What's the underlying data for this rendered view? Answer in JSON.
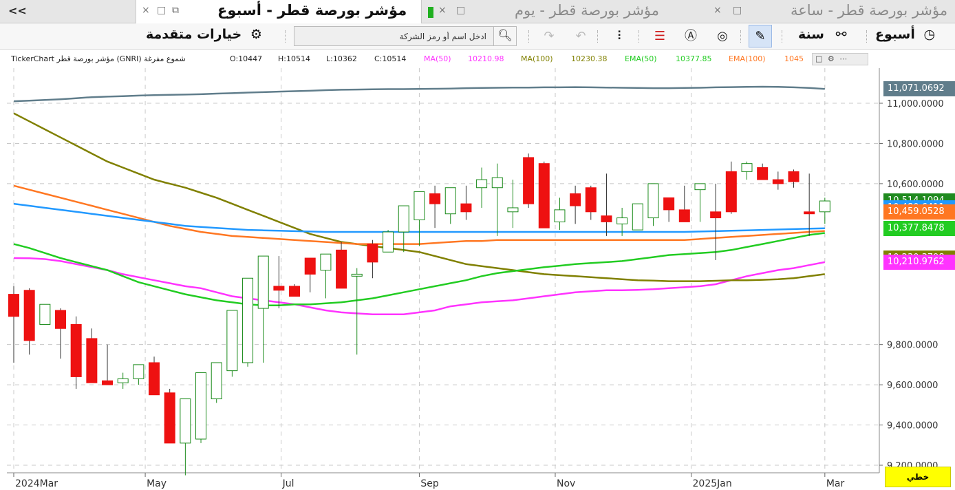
{
  "tabs": {
    "scroll_label": "<<",
    "items": [
      {
        "title": "مؤشر بورصة قطر - أسبوع",
        "active": true,
        "flag_color": ""
      },
      {
        "title": "مؤشر بورصة قطر - يوم",
        "active": false,
        "flag_color": "#20b020"
      },
      {
        "title": "مؤشر بورصة قطر - ساعة",
        "active": false,
        "flag_color": "#ffffff"
      }
    ],
    "close_glyph": "×",
    "restore_glyph": "□"
  },
  "toolbar": {
    "period_week": "أسبوع",
    "period_year": "سنة",
    "advanced_options": "خيارات متقدمة",
    "search_placeholder": "ادخل اسم أو رمز الشركة",
    "icons": [
      "clock-icon",
      "link-icon",
      "draw-tool-icon",
      "indicator-icon",
      "auto-icon",
      "horizontal-lines-icon",
      "candle-type-icon",
      "redo-icon",
      "undo-icon",
      "search-icon",
      "gear-icon"
    ]
  },
  "info_line": {
    "source": "TickerChart مؤشر بورصة قطر (GNRI) شموع مفرغة",
    "open": "O:10447",
    "high": "H:10514",
    "low": "L:10362",
    "close": "C:10514",
    "ma50_label": "MA(50)",
    "ma50_value": "10210.98",
    "ma100_label": "MA(100)",
    "ma100_value": "10230.38",
    "ema50_label": "EMA(50)",
    "ema50_value": "10377.85",
    "ema100_label": "EMA(100)",
    "ema100_value": "1045",
    "colors": {
      "ma50": "#ff33ff",
      "ma100": "#808000",
      "ema50": "#22cc22",
      "ema100": "#ff7722"
    }
  },
  "chart_data": {
    "type": "candlestick",
    "symbol": "GNRI",
    "x": [
      "2024-03-03",
      "2024-03-10",
      "2024-03-17",
      "2024-03-24",
      "2024-03-31",
      "2024-04-07",
      "2024-04-14",
      "2024-04-21",
      "2024-04-28",
      "2024-05-05",
      "2024-05-12",
      "2024-05-19",
      "2024-05-26",
      "2024-06-02",
      "2024-06-09",
      "2024-06-16",
      "2024-06-23",
      "2024-06-30",
      "2024-07-07",
      "2024-07-14",
      "2024-07-21",
      "2024-07-28",
      "2024-08-04",
      "2024-08-11",
      "2024-08-18",
      "2024-08-25",
      "2024-09-01",
      "2024-09-08",
      "2024-09-15",
      "2024-09-22",
      "2024-09-29",
      "2024-10-06",
      "2024-10-13",
      "2024-10-20",
      "2024-10-27",
      "2024-11-03",
      "2024-11-10",
      "2024-11-17",
      "2024-11-24",
      "2024-12-01",
      "2024-12-08",
      "2024-12-15",
      "2024-12-22",
      "2024-12-29",
      "2025-01-05",
      "2025-01-12",
      "2025-01-19",
      "2025-01-26",
      "2025-02-02",
      "2025-02-09",
      "2025-02-16",
      "2025-02-23",
      "2025-03-02"
    ],
    "open": [
      10050,
      10070,
      9900,
      9970,
      9900,
      9830,
      9620,
      9610,
      9630,
      9710,
      9560,
      9310,
      9330,
      9530,
      9670,
      9710,
      9980,
      10090,
      10090,
      10230,
      10170,
      10270,
      10140,
      10300,
      10260,
      10360,
      10420,
      10550,
      10450,
      10500,
      10580,
      10580,
      10460,
      10730,
      10700,
      10410,
      10550,
      10580,
      10440,
      10400,
      10370,
      10430,
      10530,
      10470,
      10570,
      10460,
      10660,
      10660,
      10680,
      10620,
      10660,
      10460,
      10460
    ],
    "high": [
      10090,
      10080,
      9950,
      9980,
      9940,
      9880,
      9800,
      9660,
      9690,
      9740,
      9580,
      9340,
      9530,
      9660,
      9720,
      9980,
      10100,
      10240,
      10100,
      10220,
      10250,
      10310,
      10180,
      10320,
      10370,
      10490,
      10560,
      10590,
      10580,
      10590,
      10680,
      10700,
      10620,
      10750,
      10710,
      10530,
      10590,
      10590,
      10650,
      10480,
      10490,
      10600,
      10520,
      10590,
      10580,
      10600,
      10710,
      10710,
      10700,
      10660,
      10670,
      10650,
      10530
    ],
    "low": [
      9710,
      9750,
      9900,
      9730,
      9580,
      9620,
      9600,
      9580,
      9600,
      9580,
      9340,
      9150,
      9310,
      9510,
      9640,
      9690,
      9710,
      9980,
      10080,
      10060,
      10030,
      10200,
      9750,
      10130,
      10260,
      10260,
      10290,
      10380,
      10400,
      10420,
      10480,
      10340,
      10380,
      10480,
      10380,
      10370,
      10400,
      10420,
      10340,
      10340,
      10370,
      10390,
      10410,
      10410,
      10410,
      10220,
      10450,
      10620,
      10650,
      10570,
      10580,
      10340,
      10400
    ],
    "close": [
      9940,
      9820,
      10000,
      9880,
      9640,
      9610,
      9600,
      9630,
      9700,
      9550,
      9310,
      9530,
      9660,
      9710,
      9970,
      10130,
      10240,
      10070,
      10040,
      10150,
      10250,
      10080,
      10150,
      10210,
      10360,
      10490,
      10560,
      10500,
      10580,
      10460,
      10620,
      10630,
      10480,
      10500,
      10380,
      10470,
      10490,
      10460,
      10410,
      10430,
      10500,
      10600,
      10470,
      10410,
      10600,
      10430,
      10460,
      10700,
      10620,
      10600,
      10610,
      10450,
      10514
    ],
    "series": [
      {
        "name": "MA(50)",
        "color": "#ff33ff",
        "values": [
          10230,
          10229,
          10225,
          10215,
          10200,
          10185,
          10170,
          10150,
          10135,
          10120,
          10105,
          10090,
          10080,
          10060,
          10040,
          10030,
          10020,
          10010,
          10000,
          9985,
          9970,
          9960,
          9955,
          9950,
          9950,
          9950,
          9960,
          9970,
          9990,
          10000,
          10010,
          10015,
          10020,
          10030,
          10040,
          10050,
          10060,
          10065,
          10070,
          10070,
          10072,
          10075,
          10080,
          10085,
          10090,
          10100,
          10120,
          10140,
          10155,
          10170,
          10180,
          10195,
          10210
        ]
      },
      {
        "name": "MA(100)",
        "color": "#808000",
        "values": [
          10950,
          10910,
          10870,
          10830,
          10790,
          10750,
          10710,
          10680,
          10650,
          10620,
          10600,
          10580,
          10555,
          10530,
          10500,
          10470,
          10440,
          10410,
          10380,
          10350,
          10330,
          10310,
          10300,
          10290,
          10280,
          10270,
          10260,
          10240,
          10220,
          10200,
          10190,
          10180,
          10170,
          10160,
          10150,
          10145,
          10140,
          10135,
          10130,
          10125,
          10120,
          10118,
          10115,
          10115,
          10115,
          10117,
          10120,
          10120,
          10122,
          10125,
          10130,
          10140,
          10150
        ]
      },
      {
        "name": "EMA(50)",
        "color": "#22cc22",
        "values": [
          10300,
          10280,
          10255,
          10230,
          10210,
          10190,
          10170,
          10140,
          10110,
          10090,
          10070,
          10050,
          10035,
          10020,
          10010,
          10000,
          9995,
          9995,
          10000,
          10000,
          10005,
          10010,
          10020,
          10030,
          10045,
          10060,
          10075,
          10090,
          10105,
          10120,
          10140,
          10155,
          10165,
          10175,
          10185,
          10192,
          10200,
          10205,
          10210,
          10215,
          10225,
          10235,
          10245,
          10250,
          10255,
          10260,
          10270,
          10285,
          10300,
          10315,
          10330,
          10345,
          10355
        ]
      },
      {
        "name": "EMA(100)",
        "color": "#ff7722",
        "values": [
          10590,
          10570,
          10550,
          10530,
          10510,
          10490,
          10470,
          10450,
          10430,
          10410,
          10390,
          10375,
          10360,
          10350,
          10340,
          10335,
          10330,
          10325,
          10320,
          10315,
          10310,
          10305,
          10300,
          10300,
          10300,
          10300,
          10300,
          10305,
          10310,
          10315,
          10315,
          10320,
          10320,
          10320,
          10320,
          10320,
          10320,
          10320,
          10320,
          10320,
          10320,
          10320,
          10320,
          10320,
          10325,
          10330,
          10335,
          10340,
          10345,
          10350,
          10355,
          10360,
          10365
        ]
      },
      {
        "name": "",
        "color": "#2299ff",
        "values": [
          10500,
          10490,
          10480,
          10470,
          10460,
          10450,
          10440,
          10430,
          10420,
          10410,
          10400,
          10390,
          10385,
          10380,
          10375,
          10370,
          10368,
          10366,
          10364,
          10362,
          10360,
          10360,
          10360,
          10360,
          10360,
          10360,
          10360,
          10360,
          10360,
          10360,
          10360,
          10360,
          10360,
          10360,
          10360,
          10360,
          10360,
          10360,
          10360,
          10360,
          10360,
          10360,
          10360,
          10360,
          10362,
          10364,
          10366,
          10368,
          10370,
          10372,
          10374,
          10376,
          10378
        ]
      },
      {
        "name": "",
        "color": "#607d8b",
        "values": [
          11010,
          11013,
          11016,
          11020,
          11025,
          11030,
          11033,
          11035,
          11038,
          11040,
          11042,
          11043,
          11045,
          11048,
          11050,
          11053,
          11055,
          11058,
          11060,
          11062,
          11065,
          11067,
          11068,
          11069,
          11070,
          11070,
          11071,
          11072,
          11073,
          11075,
          11076,
          11077,
          11078,
          11078,
          11079,
          11079,
          11080,
          11079,
          11078,
          11077,
          11076,
          11075,
          11075,
          11076,
          11077,
          11079,
          11080,
          11081,
          11082,
          11081,
          11079,
          11076,
          11071
        ]
      }
    ],
    "y_ticks": [
      "9,200.0000",
      "9,400.0000",
      "9,600.0000",
      "9,800.0000",
      "11,000.0000",
      "10,800.0000",
      "10,600.0000"
    ],
    "y_tick_values": [
      9200,
      9400,
      9600,
      9800,
      11000,
      10800,
      10600
    ],
    "x_tick_labels": [
      "2024Mar",
      "May",
      "Jul",
      "Sep",
      "Nov",
      "2025Jan",
      "Mar"
    ],
    "x_tick_dates": [
      "2024-03-03",
      "2024-05-01",
      "2024-07-01",
      "2024-09-01",
      "2024-11-01",
      "2025-01-01",
      "2025-03-02"
    ],
    "ylim": [
      9150,
      11140
    ],
    "last_value_badges": [
      {
        "text": "11,071.0692",
        "value": 11071.0692,
        "color": "#607d8b"
      },
      {
        "text": "10,514.1094",
        "value": 10514.1094,
        "color": "#1f8a1f"
      },
      {
        "text": "10,480.6411",
        "value": 10480.6411,
        "color": "#2299ff"
      },
      {
        "text": "10,459.0528",
        "value": 10459.0528,
        "color": "#ff7722"
      },
      {
        "text": "10,377.8478",
        "value": 10377.8478,
        "color": "#22cc22"
      },
      {
        "text": "10,230.3798",
        "value": 10230.3798,
        "color": "#808000"
      },
      {
        "text": "10,210.9762",
        "value": 10210.9762,
        "color": "#ff33ff"
      }
    ],
    "line_type_label": "خطي"
  }
}
